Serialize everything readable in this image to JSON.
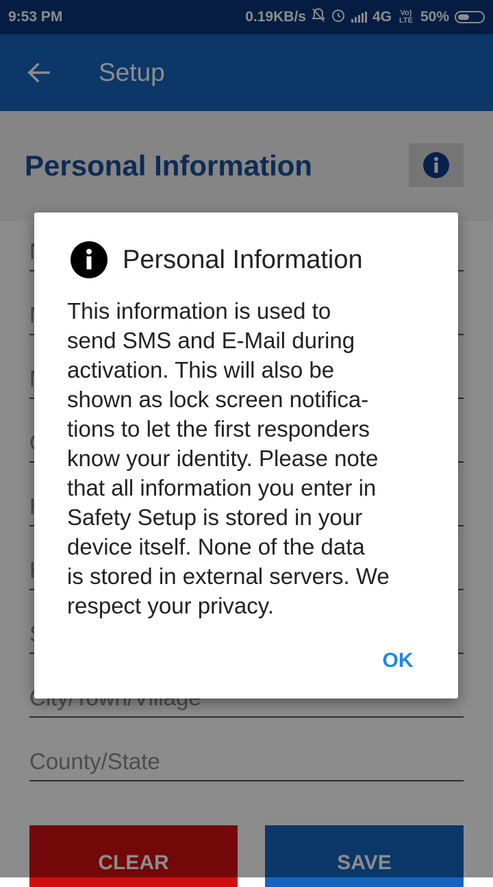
{
  "status_bar": {
    "time": "9:53 PM",
    "speed": "0.19KB/s",
    "network": "4G",
    "volte": "Vo) LTE",
    "battery": "50%"
  },
  "app_bar": {
    "title": "Setup"
  },
  "section": {
    "title": "Personal Information"
  },
  "fields": [
    {
      "placeholder": "N"
    },
    {
      "placeholder": "M"
    },
    {
      "placeholder": "M"
    },
    {
      "placeholder": "O"
    },
    {
      "placeholder": "H"
    },
    {
      "placeholder": "H"
    },
    {
      "placeholder": "S"
    },
    {
      "placeholder": "City/Town/Village"
    },
    {
      "placeholder": "County/State"
    }
  ],
  "buttons": {
    "clear": "CLEAR",
    "save": "SAVE"
  },
  "dialog": {
    "title": "Personal Information",
    "lines": [
      "This information is used to",
      "send SMS and E-Mail during",
      "activation. This will also be",
      "shown as lock screen notifica-",
      "tions to let the first responders",
      "know your identity. Please note",
      "that all information you enter in",
      "Safety Setup is stored in your",
      "device itself. None of the data",
      "is stored in external servers. We",
      "respect your privacy."
    ],
    "ok": "OK"
  },
  "colors": {
    "status_bar": "#0a3578",
    "app_bar": "#1565c0",
    "section_title": "#1a4f9c",
    "clear_button": "#d01010",
    "save_button": "#1565c0",
    "ok_text": "#1e88e5"
  }
}
